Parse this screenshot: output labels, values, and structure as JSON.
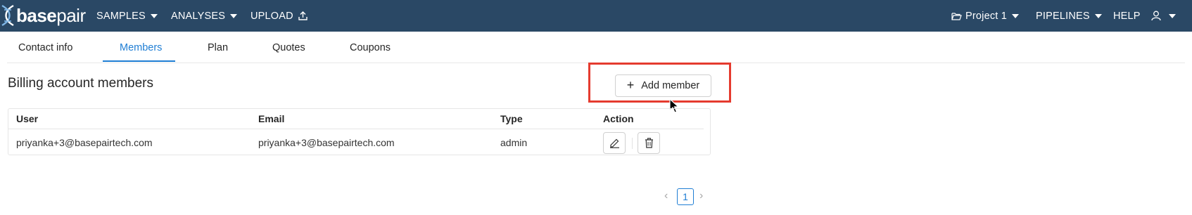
{
  "app": {
    "logo_text_bold": "base",
    "logo_text_light": "pair",
    "brand_color": "#2a4865",
    "accent_color": "#1f7ed4"
  },
  "nav": {
    "samples": "SAMPLES",
    "analyses": "ANALYSES",
    "upload": "UPLOAD",
    "project": "Project 1",
    "pipelines": "PIPELINES",
    "help": "HELP"
  },
  "tabs": [
    {
      "label": "Contact info",
      "active": false
    },
    {
      "label": "Members",
      "active": true
    },
    {
      "label": "Plan",
      "active": false
    },
    {
      "label": "Quotes",
      "active": false
    },
    {
      "label": "Coupons",
      "active": false
    }
  ],
  "section": {
    "title": "Billing account members",
    "add_button": "Add member"
  },
  "table": {
    "headers": [
      "User",
      "Email",
      "Type",
      "Action"
    ],
    "rows": [
      {
        "user": "priyanka+3@basepairtech.com",
        "email": "priyanka+3@basepairtech.com",
        "type": "admin"
      }
    ]
  },
  "pagination": {
    "current_page": "1"
  },
  "icons": [
    "folder-icon",
    "upload-icon",
    "user-icon",
    "plus-icon",
    "edit-icon",
    "trash-icon",
    "chevron-left-icon",
    "chevron-right-icon",
    "cursor-icon"
  ],
  "highlight_color": "#e53b2f"
}
